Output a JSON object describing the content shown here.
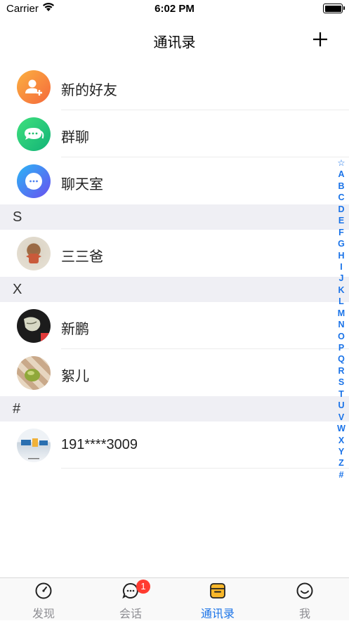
{
  "status_bar": {
    "carrier": "Carrier",
    "time": "6:02 PM"
  },
  "header": {
    "title": "通讯录"
  },
  "top_entries": [
    {
      "label": "新的好友",
      "icon": "add-friend-icon",
      "color": "#f7844f"
    },
    {
      "label": "群聊",
      "icon": "group-chat-icon",
      "color": "#2bc77a"
    },
    {
      "label": "聊天室",
      "icon": "chat-room-icon",
      "color": "#3478f6"
    }
  ],
  "sections": [
    {
      "letter": "S",
      "contacts": [
        {
          "name": "三三爸"
        }
      ]
    },
    {
      "letter": "X",
      "contacts": [
        {
          "name": "新鹏"
        },
        {
          "name": "絮儿"
        }
      ]
    },
    {
      "letter": "#",
      "contacts": [
        {
          "name": "191****3009"
        }
      ]
    }
  ],
  "index_letters": [
    "☆",
    "A",
    "B",
    "C",
    "D",
    "E",
    "F",
    "G",
    "H",
    "I",
    "J",
    "K",
    "L",
    "M",
    "N",
    "O",
    "P",
    "Q",
    "R",
    "S",
    "T",
    "U",
    "V",
    "W",
    "X",
    "Y",
    "Z",
    "#"
  ],
  "tabs": [
    {
      "label": "发现",
      "icon": "compass-icon",
      "active": false
    },
    {
      "label": "会话",
      "icon": "chat-bubble-icon",
      "active": false,
      "badge": "1"
    },
    {
      "label": "通讯录",
      "icon": "contacts-box-icon",
      "active": true
    },
    {
      "label": "我",
      "icon": "smiley-icon",
      "active": false
    }
  ],
  "accent_color": "#1a73e8"
}
